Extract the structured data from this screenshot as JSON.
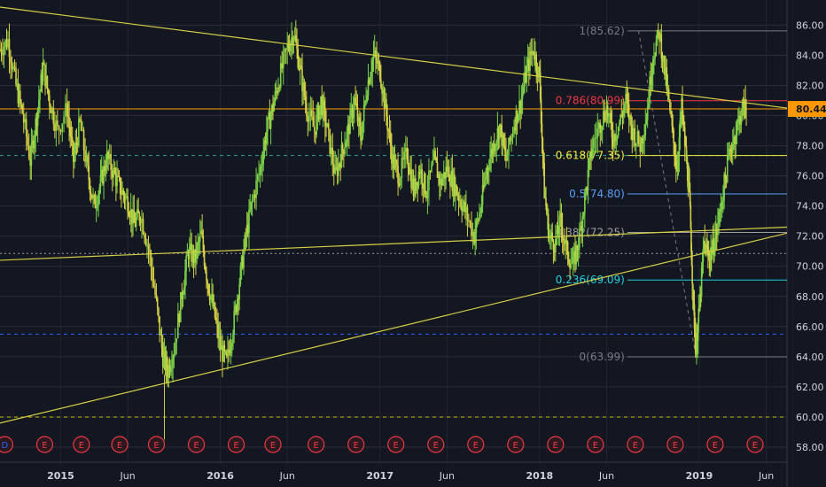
{
  "chart_data": {
    "type": "candlestick",
    "price_axis": {
      "ticks": [
        "86.00",
        "84.00",
        "82.00",
        "80.00",
        "78.00",
        "76.00",
        "74.00",
        "72.00",
        "70.00",
        "68.00",
        "66.00",
        "64.00",
        "62.00",
        "60.00",
        "58.00"
      ],
      "range": [
        57.0,
        87.2
      ],
      "last_price_label": "80.44",
      "last_price": 80.44
    },
    "time_axis": {
      "ticks": [
        {
          "label": "2015",
          "t": 2015.0
        },
        {
          "label": "Jun",
          "t": 2015.42
        },
        {
          "label": "2016",
          "t": 2016.0
        },
        {
          "label": "Jun",
          "t": 2016.42
        },
        {
          "label": "2017",
          "t": 2017.0
        },
        {
          "label": "Jun",
          "t": 2017.42
        },
        {
          "label": "2018",
          "t": 2018.0
        },
        {
          "label": "Jun",
          "t": 2018.42
        },
        {
          "label": "2019",
          "t": 2019.0
        },
        {
          "label": "Jun",
          "t": 2019.42
        }
      ]
    },
    "fibonacci": [
      {
        "label": "1(85.62)",
        "price": 85.62,
        "color": "#787b86"
      },
      {
        "label": "0.786(80.99)",
        "price": 80.99,
        "color": "#f23645"
      },
      {
        "label": "0.618(77.35)",
        "price": 77.35,
        "color": "#f5eb3b"
      },
      {
        "label": "0.5(74.80)",
        "price": 74.8,
        "color": "#5b9cf6"
      },
      {
        "label": "0.382(72.25)",
        "price": 72.25,
        "color": "#9e9e9e"
      },
      {
        "label": "0.236(69.09)",
        "price": 69.09,
        "color": "#22d0dd"
      },
      {
        "label": "0(63.99)",
        "price": 63.99,
        "color": "#787b86"
      }
    ],
    "horizontal_lines": [
      {
        "price": 80.44,
        "color": "#ff9800",
        "style": "solid"
      },
      {
        "price": 77.35,
        "color": "#26a69a",
        "style": "dashed"
      },
      {
        "price": 70.85,
        "color": "#9e9e9e",
        "style": "dotted"
      },
      {
        "price": 65.5,
        "color": "#2962ff",
        "style": "dashed"
      },
      {
        "price": 60.0,
        "color": "#c9c200",
        "style": "dashed"
      }
    ],
    "trendlines": [
      {
        "from": [
          2014.62,
          87.2
        ],
        "to": [
          2019.55,
          80.5
        ],
        "color": "#d4cf45"
      },
      {
        "from": [
          2014.62,
          70.4
        ],
        "to": [
          2019.55,
          72.6
        ],
        "color": "#d4cf45"
      },
      {
        "from": [
          2014.62,
          59.6
        ],
        "to": [
          2019.55,
          72.2
        ],
        "color": "#d4cf45"
      }
    ],
    "events": {
      "label": "E",
      "first_label": "D",
      "times": [
        2014.65,
        2014.9,
        2015.13,
        2015.37,
        2015.6,
        2015.85,
        2016.1,
        2016.33,
        2016.6,
        2016.85,
        2017.1,
        2017.35,
        2017.6,
        2017.85,
        2018.1,
        2018.35,
        2018.6,
        2018.85,
        2019.1,
        2019.35
      ]
    },
    "price_path": [
      [
        2014.62,
        84.4
      ],
      [
        2014.67,
        85.0
      ],
      [
        2014.72,
        82.0
      ],
      [
        2014.76,
        80.2
      ],
      [
        2014.81,
        77.0
      ],
      [
        2014.85,
        80.0
      ],
      [
        2014.89,
        83.3
      ],
      [
        2014.93,
        81.0
      ],
      [
        2014.98,
        79.0
      ],
      [
        2015.04,
        80.5
      ],
      [
        2015.08,
        77.0
      ],
      [
        2015.12,
        79.5
      ],
      [
        2015.17,
        76.2
      ],
      [
        2015.21,
        74.0
      ],
      [
        2015.25,
        75.5
      ],
      [
        2015.29,
        77.2
      ],
      [
        2015.34,
        76.0
      ],
      [
        2015.38,
        75.0
      ],
      [
        2015.42,
        74.3
      ],
      [
        2015.46,
        72.8
      ],
      [
        2015.5,
        73.5
      ],
      [
        2015.55,
        71.2
      ],
      [
        2015.6,
        67.5
      ],
      [
        2015.64,
        64.0
      ],
      [
        2015.67,
        63.1
      ],
      [
        2015.71,
        64.5
      ],
      [
        2015.76,
        68.2
      ],
      [
        2015.8,
        71.0
      ],
      [
        2015.84,
        70.5
      ],
      [
        2015.88,
        72.1
      ],
      [
        2015.92,
        69.0
      ],
      [
        2015.96,
        67.0
      ],
      [
        2016.0,
        64.6
      ],
      [
        2016.04,
        63.6
      ],
      [
        2016.08,
        66.0
      ],
      [
        2016.12,
        69.0
      ],
      [
        2016.16,
        72.0
      ],
      [
        2016.2,
        74.3
      ],
      [
        2016.25,
        76.5
      ],
      [
        2016.29,
        79.0
      ],
      [
        2016.33,
        80.6
      ],
      [
        2016.37,
        82.5
      ],
      [
        2016.42,
        84.5
      ],
      [
        2016.46,
        85.5
      ],
      [
        2016.5,
        83.0
      ],
      [
        2016.54,
        80.5
      ],
      [
        2016.59,
        79.0
      ],
      [
        2016.63,
        81.0
      ],
      [
        2016.67,
        79.0
      ],
      [
        2016.72,
        76.0
      ],
      [
        2016.76,
        77.5
      ],
      [
        2016.8,
        79.0
      ],
      [
        2016.84,
        81.0
      ],
      [
        2016.88,
        78.5
      ],
      [
        2016.92,
        82.0
      ],
      [
        2016.96,
        84.0
      ],
      [
        2017.0,
        83.0
      ],
      [
        2017.04,
        80.0
      ],
      [
        2017.08,
        77.0
      ],
      [
        2017.12,
        76.0
      ],
      [
        2017.17,
        77.5
      ],
      [
        2017.21,
        75.0
      ],
      [
        2017.25,
        76.5
      ],
      [
        2017.29,
        75.0
      ],
      [
        2017.34,
        77.0
      ],
      [
        2017.38,
        75.5
      ],
      [
        2017.42,
        76.5
      ],
      [
        2017.46,
        75.5
      ],
      [
        2017.5,
        74.5
      ],
      [
        2017.54,
        73.5
      ],
      [
        2017.59,
        72.0
      ],
      [
        2017.63,
        73.8
      ],
      [
        2017.67,
        76.5
      ],
      [
        2017.71,
        78.0
      ],
      [
        2017.75,
        79.3
      ],
      [
        2017.79,
        77.0
      ],
      [
        2017.84,
        79.5
      ],
      [
        2017.88,
        80.8
      ],
      [
        2017.92,
        83.0
      ],
      [
        2017.96,
        84.5
      ],
      [
        2018.0,
        82.5
      ],
      [
        2018.03,
        75.0
      ],
      [
        2018.06,
        72.0
      ],
      [
        2018.1,
        71.5
      ],
      [
        2018.13,
        73.0
      ],
      [
        2018.17,
        71.0
      ],
      [
        2018.21,
        70.0
      ],
      [
        2018.25,
        72.0
      ],
      [
        2018.29,
        75.0
      ],
      [
        2018.33,
        78.0
      ],
      [
        2018.38,
        79.5
      ],
      [
        2018.42,
        80.5
      ],
      [
        2018.46,
        78.5
      ],
      [
        2018.5,
        79.5
      ],
      [
        2018.54,
        81.0
      ],
      [
        2018.58,
        79.0
      ],
      [
        2018.63,
        78.0
      ],
      [
        2018.67,
        80.0
      ],
      [
        2018.71,
        84.0
      ],
      [
        2018.75,
        85.5
      ],
      [
        2018.79,
        82.5
      ],
      [
        2018.83,
        79.0
      ],
      [
        2018.86,
        76.5
      ],
      [
        2018.89,
        80.5
      ],
      [
        2018.92,
        77.0
      ],
      [
        2018.94,
        74.5
      ],
      [
        2018.96,
        68.5
      ],
      [
        2018.98,
        64.2
      ],
      [
        2019.0,
        67.0
      ],
      [
        2019.03,
        71.5
      ],
      [
        2019.06,
        70.5
      ],
      [
        2019.08,
        71.0
      ],
      [
        2019.11,
        72.3
      ],
      [
        2019.15,
        75.0
      ],
      [
        2019.19,
        77.5
      ],
      [
        2019.23,
        79.0
      ],
      [
        2019.27,
        80.5
      ],
      [
        2019.3,
        80.44
      ]
    ]
  }
}
